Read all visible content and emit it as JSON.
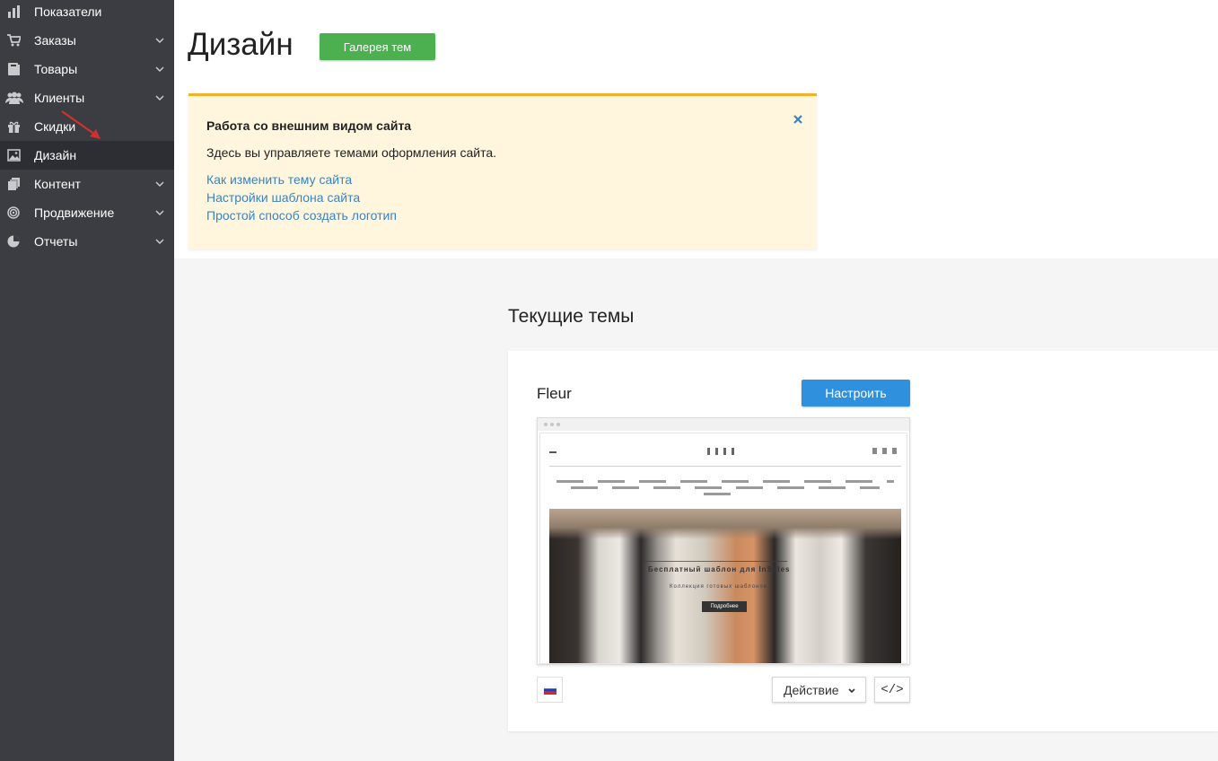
{
  "sidebar": {
    "items": [
      {
        "label": "Показатели",
        "icon": "bar-chart-icon",
        "has_submenu": false
      },
      {
        "label": "Заказы",
        "icon": "cart-icon",
        "has_submenu": true
      },
      {
        "label": "Товары",
        "icon": "book-icon",
        "has_submenu": true
      },
      {
        "label": "Клиенты",
        "icon": "users-icon",
        "has_submenu": true
      },
      {
        "label": "Скидки",
        "icon": "gift-icon",
        "has_submenu": false
      },
      {
        "label": "Дизайн",
        "icon": "image-icon",
        "has_submenu": false,
        "active": true
      },
      {
        "label": "Контент",
        "icon": "pages-icon",
        "has_submenu": true
      },
      {
        "label": "Продвижение",
        "icon": "target-icon",
        "has_submenu": true
      },
      {
        "label": "Отчеты",
        "icon": "pie-chart-icon",
        "has_submenu": true
      }
    ]
  },
  "header": {
    "title": "Дизайн",
    "gallery_button": "Галерея тем"
  },
  "notice": {
    "title": "Работа со внешним видом сайта",
    "text": "Здесь вы управляете темами оформления сайта.",
    "links": [
      "Как изменить тему сайта",
      "Настройки шаблона сайта",
      "Простой способ создать логотип"
    ]
  },
  "current_themes": {
    "section_title": "Текущие темы",
    "theme": {
      "name": "Fleur",
      "configure_button": "Настроить",
      "preview": {
        "hero_title": "Бесплатный шаблон для InSales",
        "hero_subtitle": "Коллекция готовых шаблонов",
        "hero_button": "Подробнее"
      },
      "language_flag": "ru-flag-icon",
      "action_button": "Действие",
      "code_button": "</>"
    }
  },
  "colors": {
    "sidebar_bg": "#3b3d42",
    "sidebar_active_bg": "#2c2e33",
    "gallery_green": "#4caf50",
    "configure_blue": "#2f91de",
    "notice_bg": "#fff6dd",
    "notice_border": "#f3b12b",
    "link_blue": "#3a83c3",
    "annotation_arrow": "#d32f2f"
  }
}
